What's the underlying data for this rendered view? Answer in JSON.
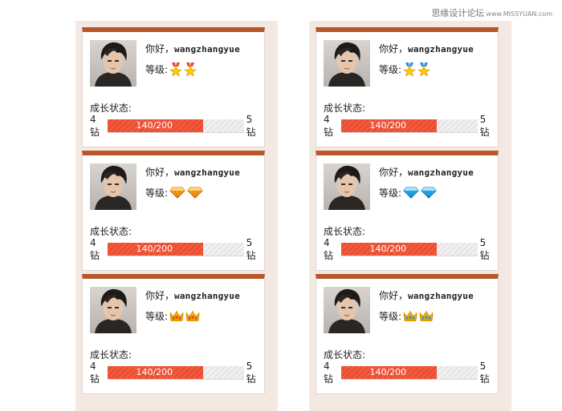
{
  "watermark": {
    "text": "思缘设计论坛",
    "site": "www.MISSYUAN.com"
  },
  "cards": [
    {
      "greeting_prefix": "你好，",
      "username": "wangzhangyue",
      "level_label": "等级:",
      "level_icon": "medal-icon",
      "growth_label": "成长状态:",
      "progress_text": "140/200",
      "progress_fraction": 0.7,
      "from_label": "4钻",
      "to_label": "5钻"
    },
    {
      "greeting_prefix": "你好，",
      "username": "wangzhangyue",
      "level_label": "等级:",
      "level_icon": "medal-blue-icon",
      "growth_label": "成长状态:",
      "progress_text": "140/200",
      "progress_fraction": 0.7,
      "from_label": "4钻",
      "to_label": "5钻"
    },
    {
      "greeting_prefix": "你好，",
      "username": "wangzhangyue",
      "level_label": "等级:",
      "level_icon": "diamond-orange-icon",
      "growth_label": "成长状态:",
      "progress_text": "140/200",
      "progress_fraction": 0.7,
      "from_label": "4钻",
      "to_label": "5钻"
    },
    {
      "greeting_prefix": "你好，",
      "username": "wangzhangyue",
      "level_label": "等级:",
      "level_icon": "diamond-blue-icon",
      "growth_label": "成长状态:",
      "progress_text": "140/200",
      "progress_fraction": 0.7,
      "from_label": "4钻",
      "to_label": "5钻"
    },
    {
      "greeting_prefix": "你好，",
      "username": "wangzhangyue",
      "level_label": "等级:",
      "level_icon": "crown-red-icon",
      "growth_label": "成长状态:",
      "progress_text": "140/200",
      "progress_fraction": 0.7,
      "from_label": "4钻",
      "to_label": "5钻"
    },
    {
      "greeting_prefix": "你好，",
      "username": "wangzhangyue",
      "level_label": "等级:",
      "level_icon": "crown-blue-icon",
      "growth_label": "成长状态:",
      "progress_text": "140/200",
      "progress_fraction": 0.7,
      "from_label": "4钻",
      "to_label": "5钻"
    }
  ],
  "colors": {
    "accent": "#b8572a",
    "progress_fill": "#f25a3d",
    "column_bg": "#f4e9e2"
  }
}
